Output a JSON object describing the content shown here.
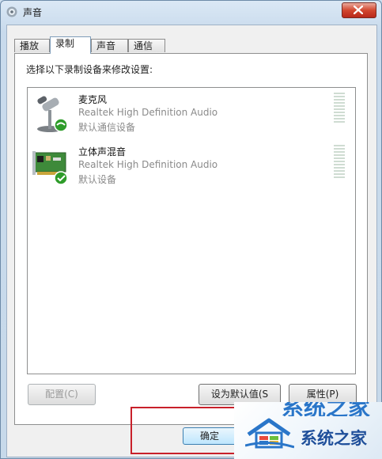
{
  "window": {
    "title": "声音"
  },
  "tabs": [
    {
      "label": "播放"
    },
    {
      "label": "录制",
      "active": true
    },
    {
      "label": "声音"
    },
    {
      "label": "通信"
    }
  ],
  "panel": {
    "instructions": "选择以下录制设备来修改设置:"
  },
  "devices": [
    {
      "name": "麦克风",
      "driver": "Realtek High Definition Audio",
      "status": "默认通信设备",
      "icon": "microphone-icon"
    },
    {
      "name": "立体声混音",
      "driver": "Realtek High Definition Audio",
      "status": "默认设备",
      "icon": "sound-card-icon"
    }
  ],
  "buttons": {
    "configure": "配置(C)",
    "set_default": "设为默认值(S",
    "properties": "属性(P)",
    "ok": "确定"
  },
  "watermark": {
    "text": "系统之家",
    "strip_text": "系统之家"
  },
  "colors": {
    "accent": "#2a76c9",
    "highlight": "#c8202a",
    "check_green": "#2e9c2a"
  }
}
